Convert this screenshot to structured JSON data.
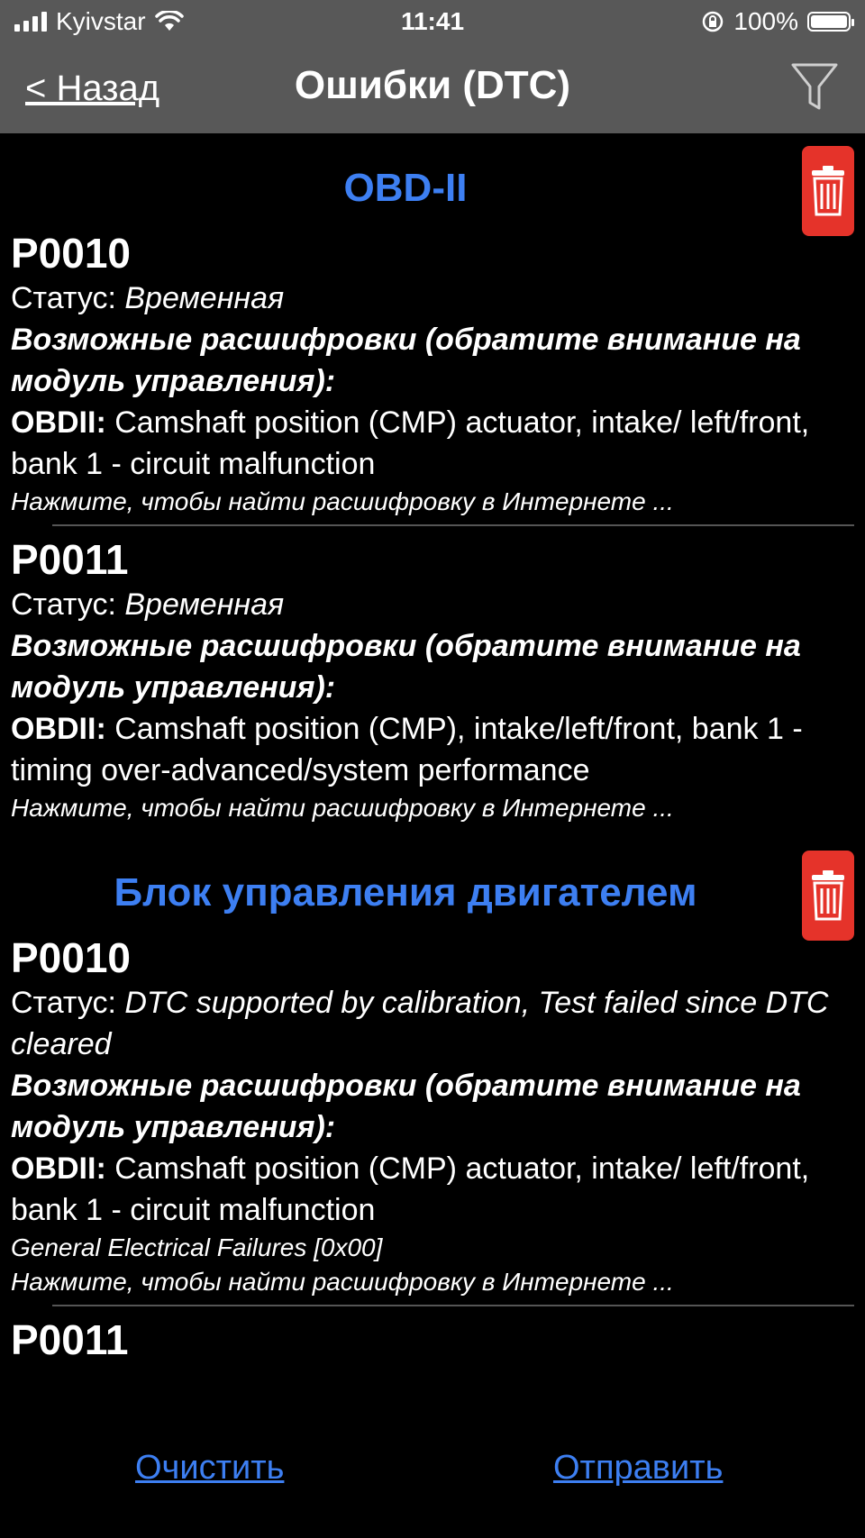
{
  "statusbar": {
    "carrier": "Kyivstar",
    "time": "11:41",
    "battery": "100%"
  },
  "nav": {
    "back_label": "< Назад",
    "title": "Ошибки (DTC)",
    "filter_icon": "filter-icon"
  },
  "labels": {
    "status_prefix": "Статус: ",
    "decodings": "Возможные расшифровки (обратите внимание на модуль управления):",
    "obd_prefix": "OBDII: ",
    "search_hint": "Нажмите, чтобы найти расшифровку в Интернете ..."
  },
  "sections": [
    {
      "title": "OBD-II",
      "items": [
        {
          "code": "P0010",
          "status": "Временная",
          "description": "Camshaft position (CMP) actuator, intake/ left/front, bank 1 - circuit malfunction"
        },
        {
          "code": "P0011",
          "status": "Временная",
          "description": "Camshaft position (CMP), intake/left/front, bank 1 - timing over-advanced/system performance"
        }
      ]
    },
    {
      "title": "Блок управления двигателем",
      "items": [
        {
          "code": "P0010",
          "status": "DTC supported by calibration, Test failed since DTC cleared",
          "description": "Camshaft position (CMP) actuator, intake/ left/front, bank 1 - circuit malfunction",
          "extra": "General Electrical Failures [0x00]"
        },
        {
          "code": "P0011"
        }
      ]
    }
  ],
  "bottom": {
    "clear_label": "Очистить",
    "send_label": "Отправить"
  },
  "colors": {
    "accent": "#3d7ff2",
    "delete": "#e5332a",
    "navbar": "#585858"
  }
}
